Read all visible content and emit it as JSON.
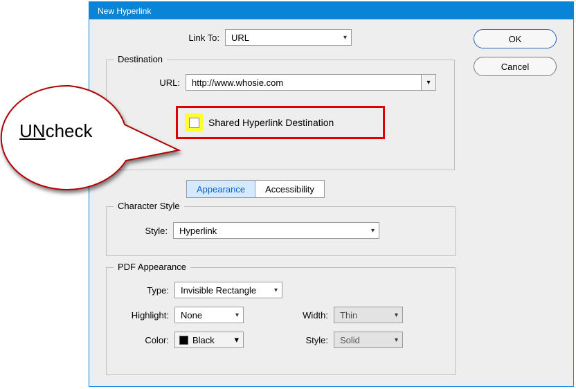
{
  "dialog": {
    "title": "New Hyperlink",
    "ok_label": "OK",
    "cancel_label": "Cancel",
    "link_to_label": "Link To:",
    "link_to_value": "URL"
  },
  "destination": {
    "legend": "Destination",
    "url_label": "URL:",
    "url_value": "http://www.whosie.com",
    "shared_label": "Shared Hyperlink Destination"
  },
  "tabs": {
    "appearance": "Appearance",
    "accessibility": "Accessibility"
  },
  "character_style": {
    "legend": "Character Style",
    "style_label": "Style:",
    "style_value": "Hyperlink"
  },
  "pdf": {
    "legend": "PDF Appearance",
    "type_label": "Type:",
    "type_value": "Invisible Rectangle",
    "highlight_label": "Highlight:",
    "highlight_value": "None",
    "color_label": "Color:",
    "color_value": "Black",
    "width_label": "Width:",
    "width_value": "Thin",
    "style_label": "Style:",
    "style_value": "Solid"
  },
  "callout": {
    "prefix": "UN",
    "rest": "check"
  }
}
